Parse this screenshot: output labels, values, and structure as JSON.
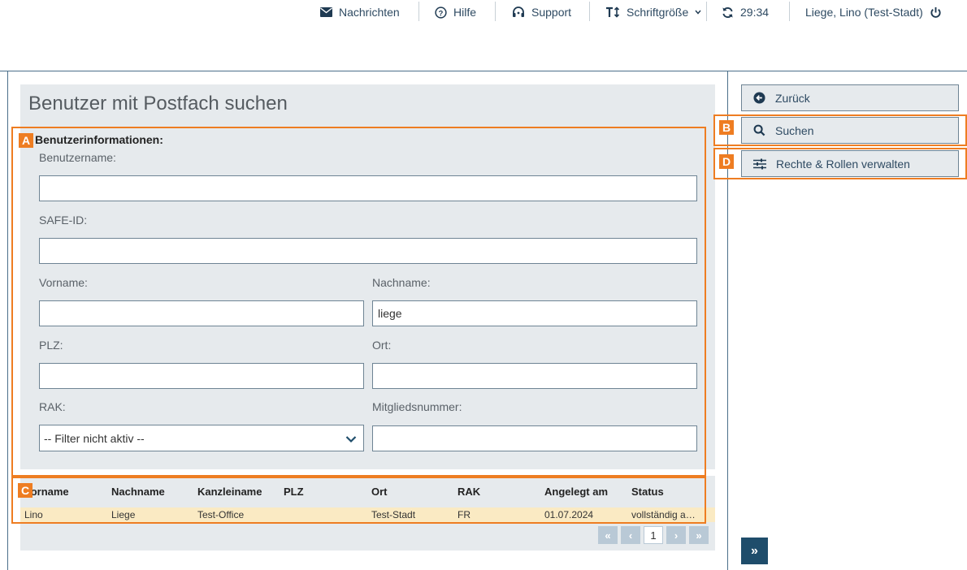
{
  "topbar": {
    "messages": "Nachrichten",
    "help": "Hilfe",
    "support": "Support",
    "font_size": "Schriftgröße",
    "session_timer": "29:34",
    "user": "Liege, Lino (Test-Stadt)"
  },
  "page": {
    "title": "Benutzer mit Postfach suchen",
    "section_title": "Benutzerinformationen:"
  },
  "form": {
    "username": {
      "label": "Benutzername:",
      "value": ""
    },
    "safe_id": {
      "label": "SAFE-ID:",
      "value": ""
    },
    "first_name": {
      "label": "Vorname:",
      "value": ""
    },
    "last_name": {
      "label": "Nachname:",
      "value": "liege"
    },
    "zip": {
      "label": "PLZ:",
      "value": ""
    },
    "city": {
      "label": "Ort:",
      "value": ""
    },
    "rak": {
      "label": "RAK:",
      "selected": "-- Filter nicht aktiv --"
    },
    "member_number": {
      "label": "Mitgliedsnummer:",
      "value": ""
    }
  },
  "table": {
    "columns": [
      "Vorname",
      "Nachname",
      "Kanzleiname",
      "PLZ",
      "Ort",
      "RAK",
      "Angelegt am",
      "Status"
    ],
    "rows": [
      [
        "Lino",
        "Liege",
        "Test-Office",
        "",
        "Test-Stadt",
        "FR",
        "01.07.2024",
        "vollständig a…"
      ]
    ],
    "row_highlight_color": "#faeac3"
  },
  "pagination": {
    "first": "«",
    "prev": "‹",
    "current_page": "1",
    "next": "›",
    "last": "»"
  },
  "sidebar": {
    "back": "Zurück",
    "search": "Suchen",
    "manage_rights": "Rechte & Rollen verwalten",
    "collapse": "»"
  },
  "annotations": {
    "a": "A",
    "b": "B",
    "c": "C",
    "d": "D",
    "color": "#ee7d22"
  },
  "icons": {
    "messages": "envelope-icon",
    "help": "question-circle-icon",
    "support": "headset-icon",
    "font_size": "text-size-icon",
    "refresh": "refresh-icon",
    "logout": "power-icon",
    "back": "arrow-left-circle-icon",
    "search": "search-icon",
    "rights": "sliders-icon"
  },
  "colors": {
    "accent": "#1f4d6b",
    "panel_bg": "#e6eaed",
    "text_link": "#2e4a62"
  }
}
